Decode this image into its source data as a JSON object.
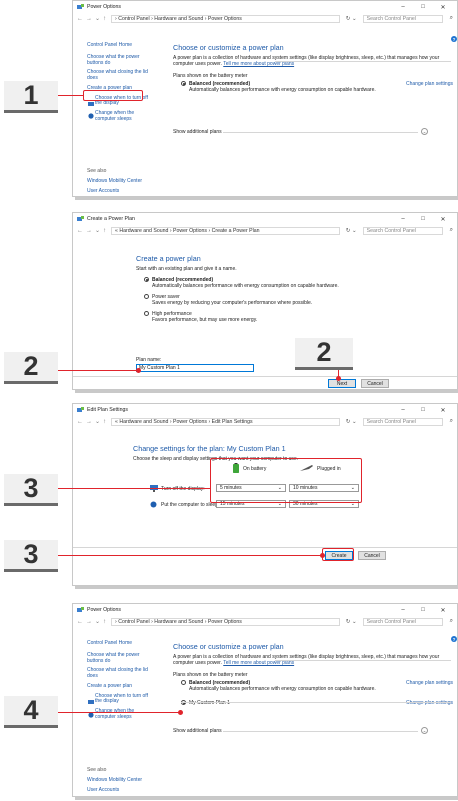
{
  "steps": [
    "1",
    "2",
    "2",
    "3",
    "3",
    "4"
  ],
  "win_controls": {
    "min": "–",
    "max": "□",
    "close": "✕"
  },
  "nav": {
    "back": "←",
    "fwd": "→",
    "down": "⌄",
    "up": "↑",
    "refresh": "↻ ⌄",
    "search_icon": "⌕"
  },
  "w1": {
    "title": "Power Options",
    "path": "› Control Panel  ›  Hardware and Sound  ›  Power Options",
    "search": "Search Control Panel",
    "left": [
      "Control Panel Home",
      "Choose what the power buttons do",
      "Choose what closing the lid does",
      "Create a power plan",
      "Choose when to turn off the display",
      "Change when the computer sleeps"
    ],
    "see_also": "See also",
    "see_also_links": [
      "Windows Mobility Center",
      "User Accounts"
    ],
    "heading": "Choose or customize a power plan",
    "desc": "A power plan is a collection of hardware and system settings (like display brightness, sleep, etc.) that manages how your computer uses power.",
    "tell_more": "Tell me more about power plans",
    "plans_label": "Plans shown on the battery meter",
    "plan": "Balanced (recommended)",
    "plan_desc": "Automatically balances performance with energy consumption on capable hardware.",
    "change": "Change plan settings",
    "show_more": "Show additional plans"
  },
  "w2": {
    "title": "Create a Power Plan",
    "path": "«  Hardware and Sound  ›  Power Options  ›  Create a Power Plan",
    "search": "Search Control Panel",
    "heading": "Create a power plan",
    "intro": "Start with an existing plan and give it a name.",
    "opts": [
      {
        "name": "Balanced (recommended)",
        "desc": "Automatically balances performance with energy consumption on capable hardware."
      },
      {
        "name": "Power saver",
        "desc": "Saves energy by reducing your computer's performance where possible."
      },
      {
        "name": "High performance",
        "desc": "Favors performance, but may use more energy."
      }
    ],
    "plan_name_label": "Plan name:",
    "plan_name_value": "My Custom Plan 1",
    "next": "Next",
    "cancel": "Cancel"
  },
  "w3": {
    "title": "Edit Plan Settings",
    "path": "«  Hardware and Sound  ›  Power Options  ›  Edit Plan Settings",
    "search": "Search Control Panel",
    "heading": "Change settings for the plan: My Custom Plan 1",
    "intro": "Choose the sleep and display settings that you want your computer to use.",
    "on_battery": "On battery",
    "plugged_in": "Plugged in",
    "row1_label": "Turn off the display:",
    "row1_bat": "5 minutes",
    "row1_plug": "10 minutes",
    "row2_label": "Put the computer to sleep:",
    "row2_bat": "15 minutes",
    "row2_plug": "30 minutes",
    "create": "Create",
    "cancel": "Cancel"
  },
  "w4": {
    "title": "Power Options",
    "path": "› Control Panel  ›  Hardware and Sound  ›  Power Options",
    "search": "Search Control Panel",
    "left": [
      "Control Panel Home",
      "Choose what the power buttons do",
      "Choose what closing the lid does",
      "Create a power plan",
      "Choose when to turn off the display",
      "Change when the computer sleeps"
    ],
    "see_also": "See also",
    "see_also_links": [
      "Windows Mobility Center",
      "User Accounts"
    ],
    "heading": "Choose or customize a power plan",
    "desc": "A power plan is a collection of hardware and system settings (like display brightness, sleep, etc.) that manages how your computer uses power.",
    "tell_more": "Tell me more about power plans",
    "plans_label": "Plans shown on the battery meter",
    "plan1": "Balanced (recommended)",
    "plan1_desc": "Automatically balances performance with energy consumption on capable hardware.",
    "plan2": "My Custom Plan 1",
    "change": "Change plan settings",
    "show_more": "Show additional plans"
  }
}
